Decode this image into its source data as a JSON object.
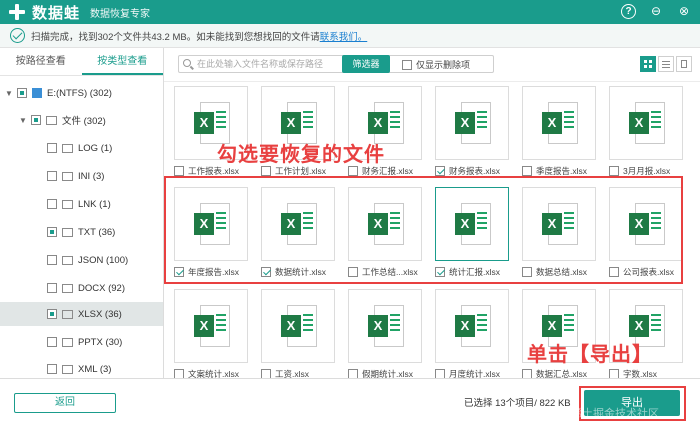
{
  "titlebar": {
    "app_name": "数据蛙",
    "app_subtitle": "数据恢复专家",
    "help": "?",
    "minimize": "⊖",
    "close": "⊗"
  },
  "status": {
    "text": "扫描完成，找到302个文件共43.2 MB。如未能找到您想找回的文件请",
    "link": "联系我们。"
  },
  "sidebar": {
    "tabs": [
      "按路径查看",
      "按类型查看"
    ],
    "active_tab": 1,
    "drive": "E:(NTFS) (302)",
    "folder": "文件 (302)",
    "types": [
      {
        "label": "LOG (1)"
      },
      {
        "label": "INI (3)"
      },
      {
        "label": "LNK (1)"
      },
      {
        "label": "TXT (36)"
      },
      {
        "label": "JSON (100)"
      },
      {
        "label": "DOCX (92)"
      },
      {
        "label": "XLSX (36)"
      },
      {
        "label": "PPTX (30)"
      },
      {
        "label": "XML (3)"
      }
    ],
    "selected_type": "XLSX (36)"
  },
  "toolbar": {
    "search_placeholder": "在此处输入文件名称或保存路径",
    "filter_label": "筛选器",
    "deleted_only_label": "仅显示删除项"
  },
  "files": [
    {
      "name": "工作报表.xlsx",
      "checked": false
    },
    {
      "name": "工作计划.xlsx",
      "checked": false
    },
    {
      "name": "财务汇报.xlsx",
      "checked": false
    },
    {
      "name": "财务报表.xlsx",
      "checked": true
    },
    {
      "name": "季度报告.xlsx",
      "checked": false
    },
    {
      "name": "3月月报.xlsx",
      "checked": false
    },
    {
      "name": "年度报告.xlsx",
      "checked": true
    },
    {
      "name": "数据统计.xlsx",
      "checked": true
    },
    {
      "name": "工作总结...xlsx",
      "checked": false
    },
    {
      "name": "统计汇报.xlsx",
      "checked": true
    },
    {
      "name": "数据总结.xlsx",
      "checked": false
    },
    {
      "name": "公司报表.xlsx",
      "checked": false
    },
    {
      "name": "文案统计.xlsx",
      "checked": false
    },
    {
      "name": "工资.xlsx",
      "checked": false
    },
    {
      "name": "假期统计.xlsx",
      "checked": false
    },
    {
      "name": "月度统计.xlsx",
      "checked": false
    },
    {
      "name": "数据汇总.xlsx",
      "checked": false
    },
    {
      "name": "字数.xlsx",
      "checked": false
    }
  ],
  "excel_badge": "X",
  "annotations": {
    "select_files": "勾选要恢复的文件",
    "click_export": "单击【导出】"
  },
  "bottom": {
    "back_label": "返回",
    "selection_info": "已选择 13个项目/ 822 KB",
    "export_label": "导出",
    "watermark": "@稀土掘金技术社区"
  },
  "colors": {
    "accent": "#1a9c8c",
    "annotation": "#e84040"
  }
}
